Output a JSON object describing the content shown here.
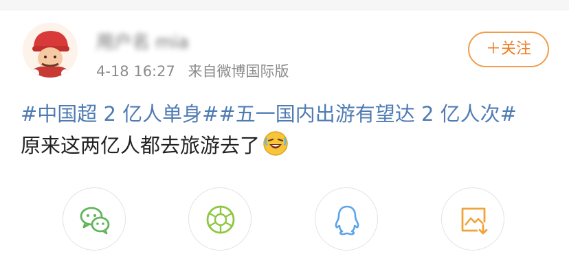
{
  "post": {
    "username": "用户名 mia",
    "time": "4-18 16:27",
    "source": "来自微博国际版",
    "follow_label": "＋关注",
    "tag1": "#中国超 2 亿人单身#",
    "tag2": "#五一国内出游有望达 2 亿人次#",
    "body": "原来这两亿人都去旅游去了"
  },
  "share": {
    "icons": [
      "wechat-icon",
      "moments-icon",
      "qq-icon",
      "save-image-icon"
    ]
  },
  "colors": {
    "tag": "#4f7bb3",
    "follow": "#f07c22",
    "wechat": "#62b35b",
    "moments": "#8dc63f",
    "qq": "#5aa4e8",
    "save": "#f0a23b"
  }
}
